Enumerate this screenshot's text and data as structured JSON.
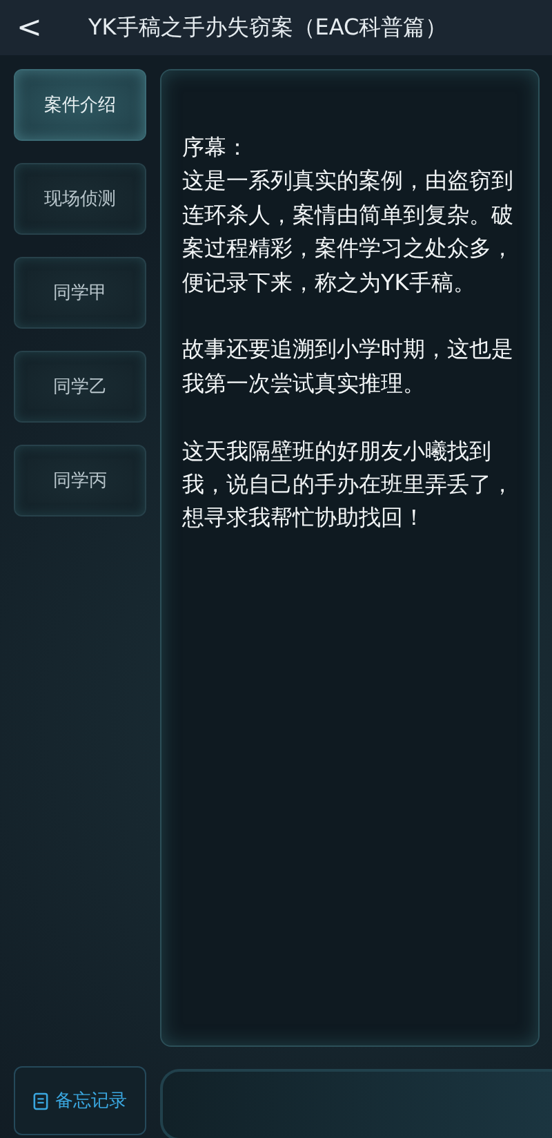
{
  "header": {
    "back": "<",
    "title": "YK手稿之手办失窃案（EAC科普篇）"
  },
  "sidebar": {
    "items": [
      {
        "label": "案件介绍",
        "selected": true
      },
      {
        "label": "现场侦测",
        "selected": false
      },
      {
        "label": "同学甲",
        "selected": false
      },
      {
        "label": "同学乙",
        "selected": false
      },
      {
        "label": "同学丙",
        "selected": false
      }
    ]
  },
  "content": {
    "heading": "序幕：",
    "paragraphs": [
      "这是一系列真实的案例，由盗窃到连环杀人，案情由简单到复杂。破案过程精彩，案件学习之处众多，便记录下来，称之为YK手稿。",
      "故事还要追溯到小学时期，这也是我第一次尝试真实推理。",
      "这天我隔壁班的好朋友小曦找到我，说自己的手办在班里弄丢了，想寻求我帮忙协助找回！"
    ]
  },
  "footer": {
    "memo": "备忘记录"
  }
}
